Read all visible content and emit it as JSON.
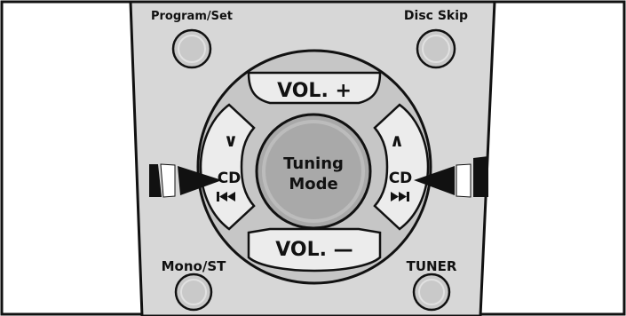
{
  "remote": {
    "buttons": {
      "program_set": "Program/Set",
      "disc_skip": "Disc Skip",
      "mono_st": "Mono/ST",
      "tuner": "TUNER"
    },
    "pad": {
      "vol_up": "VOL. +",
      "vol_down": "VOL. —",
      "center_line1": "Tuning",
      "center_line2": "Mode",
      "left_label": "CD",
      "right_label": "CD",
      "left_arrow": "∨",
      "right_arrow": "∧"
    }
  },
  "colors": {
    "body": "#d7d7d7",
    "pad_ring": "#c6c6c6",
    "pad_button": "#ececec",
    "center": "#a9a9a9",
    "outline": "#111111"
  },
  "icons": {
    "left_skip": "skip-back-icon",
    "right_skip": "skip-forward-icon",
    "left_pointer": "pointer-arrow-icon",
    "right_pointer": "pointer-arrow-icon"
  }
}
